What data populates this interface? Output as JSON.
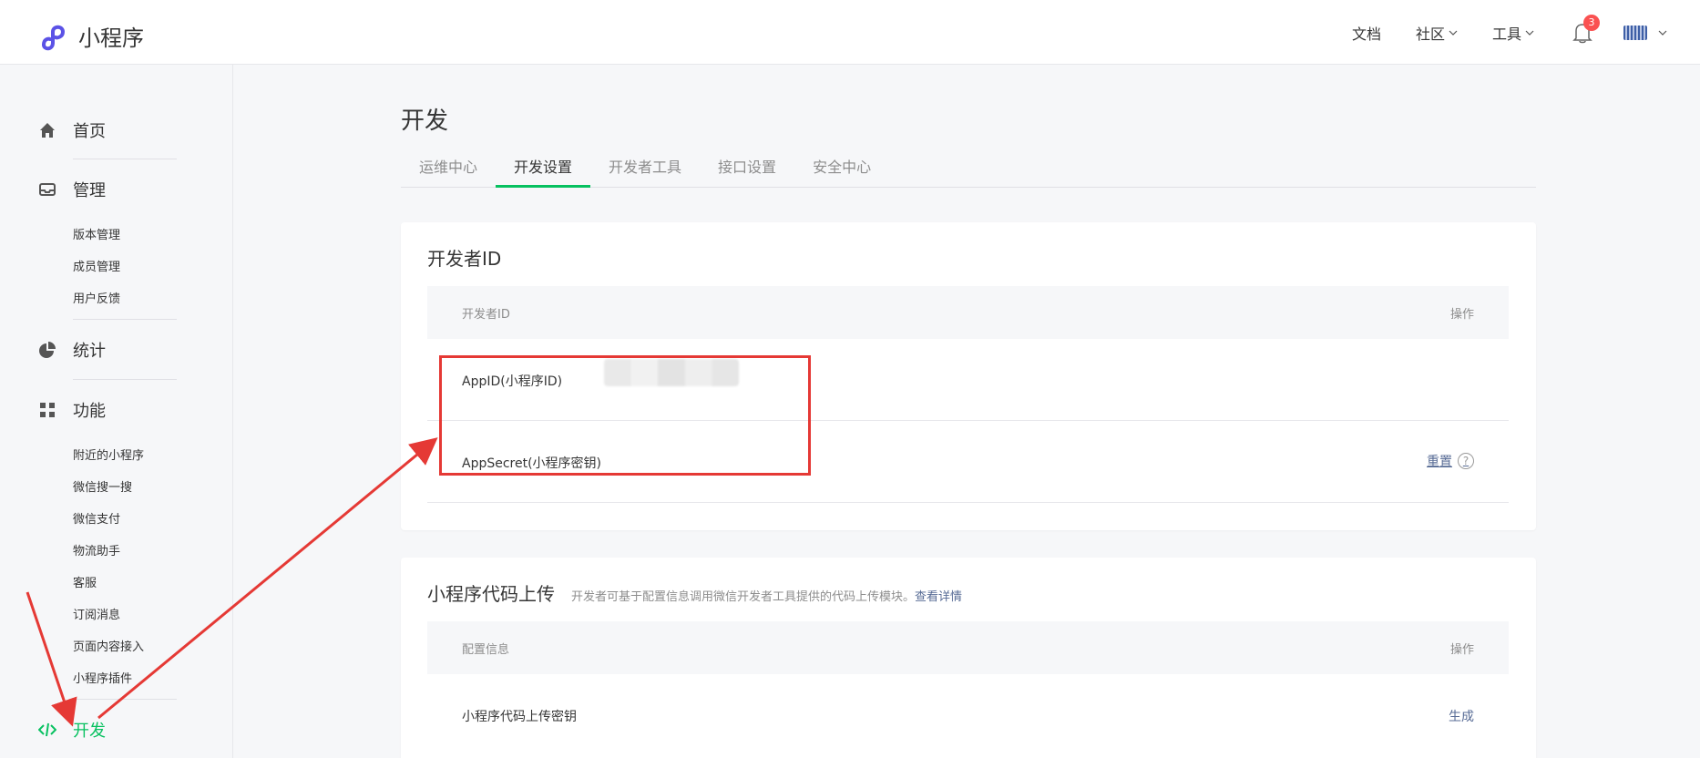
{
  "header": {
    "app_name": "小程序",
    "nav": {
      "docs": "文档",
      "community": "社区",
      "tools": "工具"
    },
    "notification_count": "3",
    "colors": {
      "brand": "#5b52e6",
      "badge": "#fa5151"
    }
  },
  "sidebar": {
    "home": "首页",
    "manage": "管理",
    "manage_items": [
      "版本管理",
      "成员管理",
      "用户反馈"
    ],
    "stats": "统计",
    "features": "功能",
    "feature_items": [
      "附近的小程序",
      "微信搜一搜",
      "微信支付",
      "物流助手",
      "客服",
      "订阅消息",
      "页面内容接入",
      "小程序插件"
    ],
    "develop": "开发",
    "colors": {
      "active": "#07c160"
    }
  },
  "main": {
    "title": "开发",
    "tabs": [
      "运维中心",
      "开发设置",
      "开发者工具",
      "接口设置",
      "安全中心"
    ],
    "active_tab": "开发设置",
    "developer_id": {
      "title": "开发者ID",
      "col_name": "开发者ID",
      "col_action": "操作",
      "appid_label": "AppID(小程序ID)",
      "appsecret_label": "AppSecret(小程序密钥)",
      "reset_action": "重置",
      "help_glyph": "?"
    },
    "code_upload": {
      "title": "小程序代码上传",
      "description": "开发者可基于配置信息调用微信开发者工具提供的代码上传模块。",
      "details_link": "查看详情",
      "col_config": "配置信息",
      "col_action": "操作",
      "key_label": "小程序代码上传密钥",
      "generate_action": "生成"
    }
  },
  "annotation": {
    "color": "#e53935"
  }
}
